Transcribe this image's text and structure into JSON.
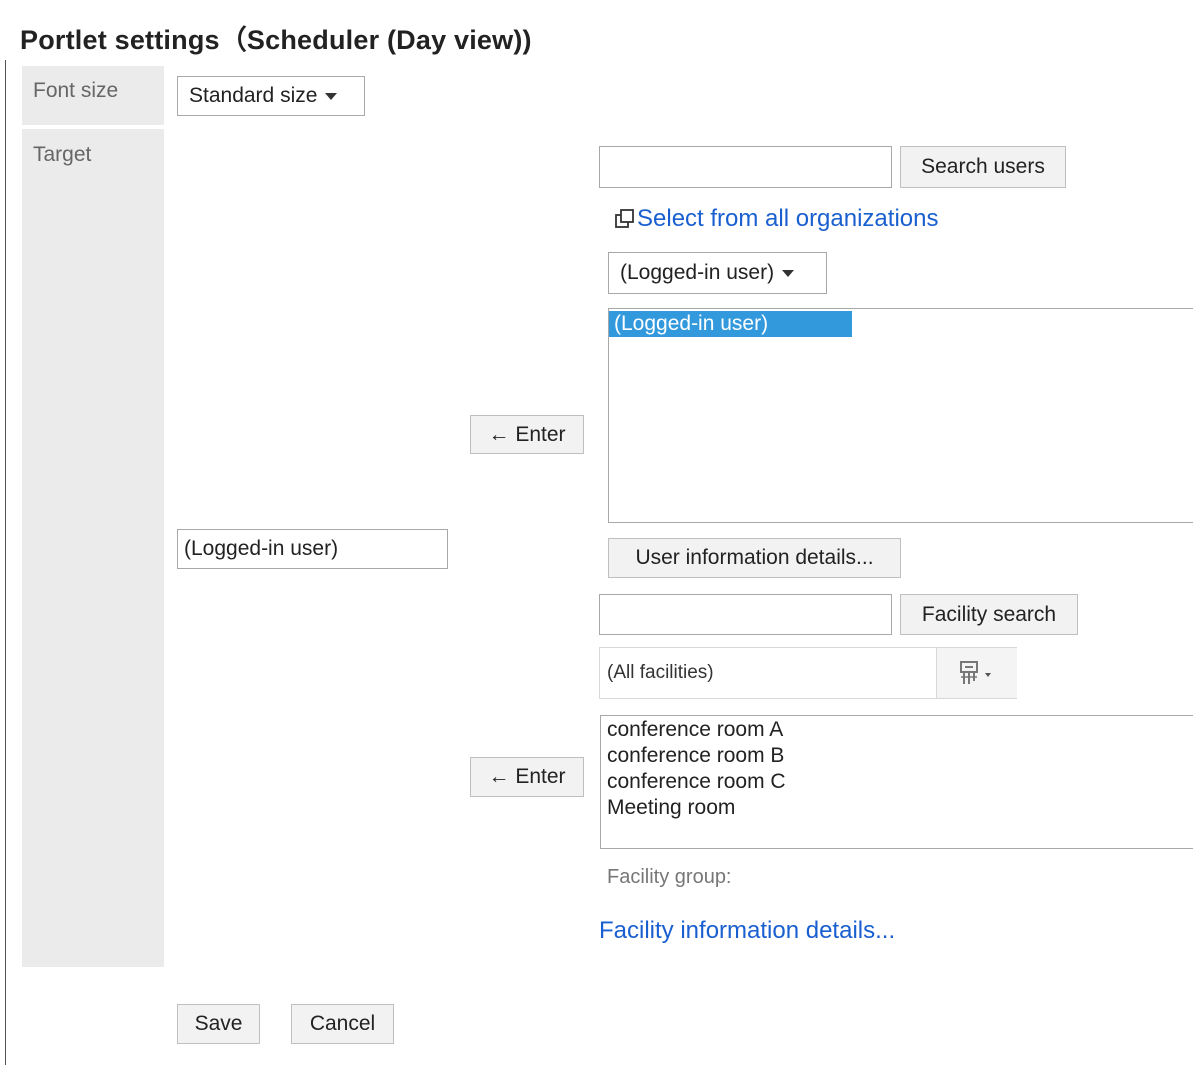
{
  "page": {
    "title": "Portlet settings（Scheduler (Day view))"
  },
  "font_size": {
    "label": "Font size",
    "selected": "Standard size"
  },
  "target": {
    "label": "Target",
    "selected_value": "(Logged-in user)",
    "users": {
      "search_button": "Search users",
      "search_value": "",
      "select_all_orgs_link": "Select from all organizations",
      "org_dropdown": "(Logged-in user)",
      "enter_button": "← Enter",
      "list": [
        {
          "label": "(Logged-in user)",
          "selected": true
        }
      ],
      "details_button": "User information details..."
    },
    "facilities": {
      "search_button": "Facility search",
      "search_value": "",
      "group_dropdown": "(All facilities)",
      "enter_button": "← Enter",
      "list": [
        {
          "label": "conference room A"
        },
        {
          "label": "conference room B"
        },
        {
          "label": "conference room C"
        },
        {
          "label": "Meeting room"
        }
      ],
      "group_label": "Facility group:",
      "details_link": "Facility information details..."
    }
  },
  "actions": {
    "save": "Save",
    "cancel": "Cancel"
  }
}
